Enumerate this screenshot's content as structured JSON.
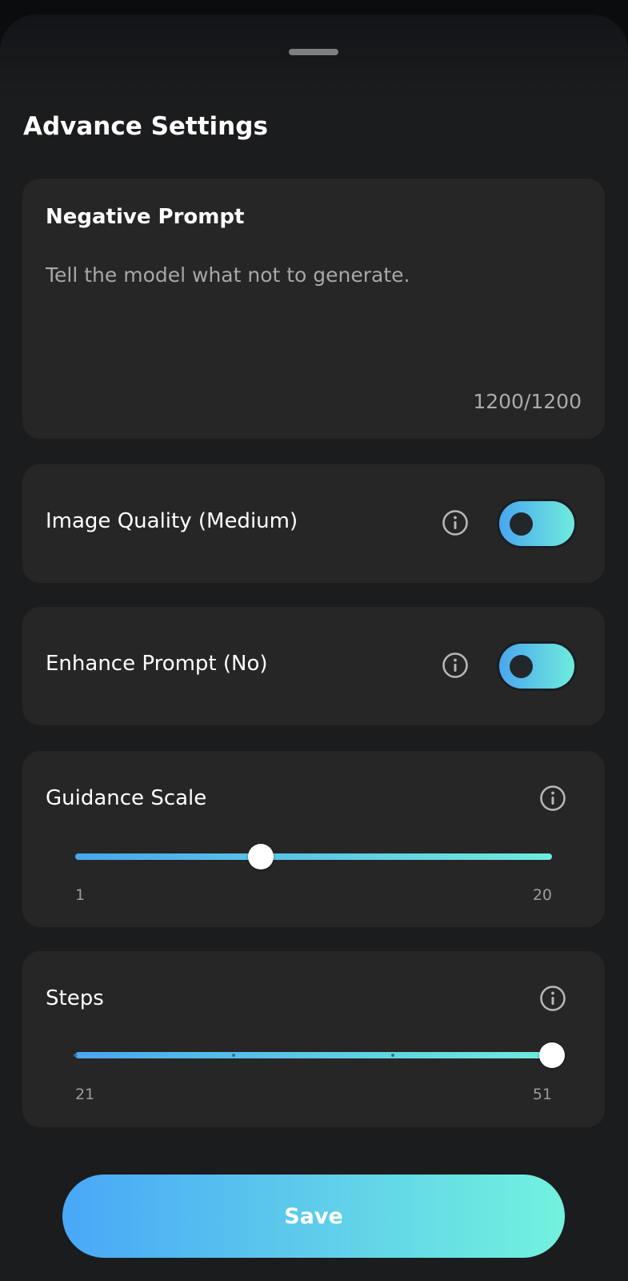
{
  "sheet": {
    "title": "Advance Settings"
  },
  "negative_prompt": {
    "title": "Negative Prompt",
    "placeholder": "Tell the model what not to generate.",
    "counter": "1200/1200"
  },
  "image_quality": {
    "label": "Image Quality (Medium)",
    "on": true
  },
  "enhance_prompt": {
    "label": "Enhance Prompt (No)",
    "on": true
  },
  "guidance_scale": {
    "label": "Guidance Scale",
    "min": "1",
    "max": "20",
    "value_fraction": 0.39
  },
  "steps": {
    "label": "Steps",
    "min": "21",
    "max": "51",
    "value_fraction": 1.0
  },
  "save": {
    "label": "Save"
  },
  "colors": {
    "accent_start": "#49a7f7",
    "accent_end": "#72f2de",
    "card": "#262627",
    "background": "#1b1c1e"
  },
  "icons": {
    "info": "info-circle-icon",
    "handle": "drag-handle-icon"
  }
}
